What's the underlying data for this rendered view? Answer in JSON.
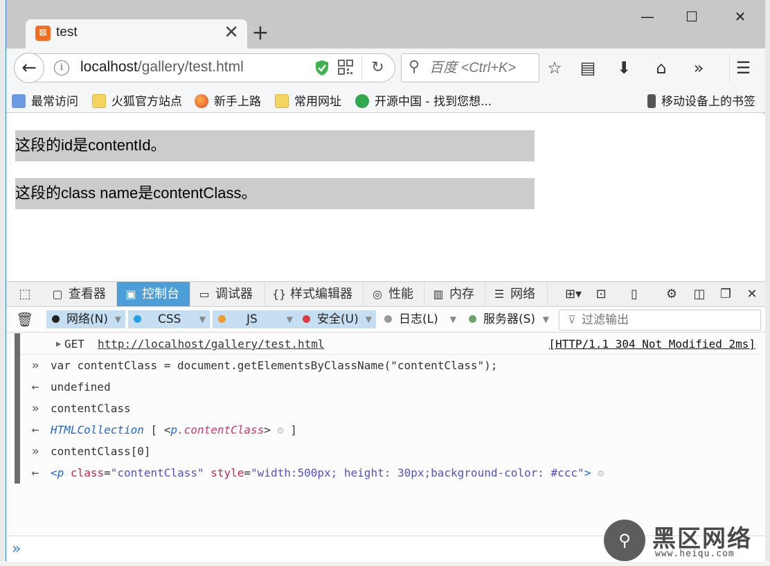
{
  "tab": {
    "title": "test"
  },
  "window_controls": {
    "minimize": "—",
    "maximize": "☐",
    "close": "✕"
  },
  "nav": {
    "url_host": "localhost",
    "url_path": "/gallery/test.html",
    "search_placeholder": "百度 <Ctrl+K>"
  },
  "bookmarks": {
    "items": [
      {
        "label": "最常访问",
        "icon": "most-visited-icon"
      },
      {
        "label": "火狐官方站点",
        "icon": "folder-icon"
      },
      {
        "label": "新手上路",
        "icon": "firefox-icon"
      },
      {
        "label": "常用网址",
        "icon": "folder-icon"
      },
      {
        "label": "开源中国 - 找到您想...",
        "icon": "oschina-icon"
      }
    ],
    "mobile": "移动设备上的书签"
  },
  "page": {
    "para_id": "这段的id是contentId。",
    "para_class": "这段的class name是contentClass。",
    "para_bg": "#cccccc"
  },
  "devtools": {
    "tabs": [
      "查看器",
      "控制台",
      "调试器",
      "样式编辑器",
      "性能",
      "内存",
      "网络"
    ],
    "active_tab": "控制台",
    "accent": "#4c9ed9",
    "filters": [
      {
        "label": "网络(N)",
        "color": "#222222",
        "on": true
      },
      {
        "label": "CSS",
        "color": "#1fa0e8",
        "on": true
      },
      {
        "label": "JS",
        "color": "#f29a23",
        "on": true
      },
      {
        "label": "安全(U)",
        "color": "#e0393e",
        "on": true
      },
      {
        "label": "日志(L)",
        "color": "#9a9a9a",
        "on": false
      },
      {
        "label": "服务器(S)",
        "color": "#6aa56a",
        "on": false
      }
    ],
    "filter_placeholder": "过滤输出"
  },
  "console": {
    "network_line": {
      "method": "GET",
      "url": "http://localhost/gallery/test.html",
      "status": "[HTTP/1.1 304 Not Modified 2ms]"
    },
    "input_1": "var contentClass = document.getElementsByClassName(\"contentClass\");",
    "output_1": "undefined",
    "input_2": "contentClass",
    "output_2_type": "HTMLCollection",
    "output_2_open": "[ <",
    "output_2_tag": "p",
    "output_2_class": ".contentClass",
    "output_2_close": ">",
    "output_2_end": "]",
    "input_3": "contentClass[0]",
    "output_3": {
      "lt": "<",
      "tag": "p",
      "class_attr": "class",
      "class_val": "\"contentClass\"",
      "style_attr": "style",
      "style_val": "\"width:500px; height: 30px;background-color: #ccc\"",
      "gt": ">"
    }
  },
  "watermark": {
    "text": "黑区网络",
    "url": "www.heiqu.com"
  }
}
